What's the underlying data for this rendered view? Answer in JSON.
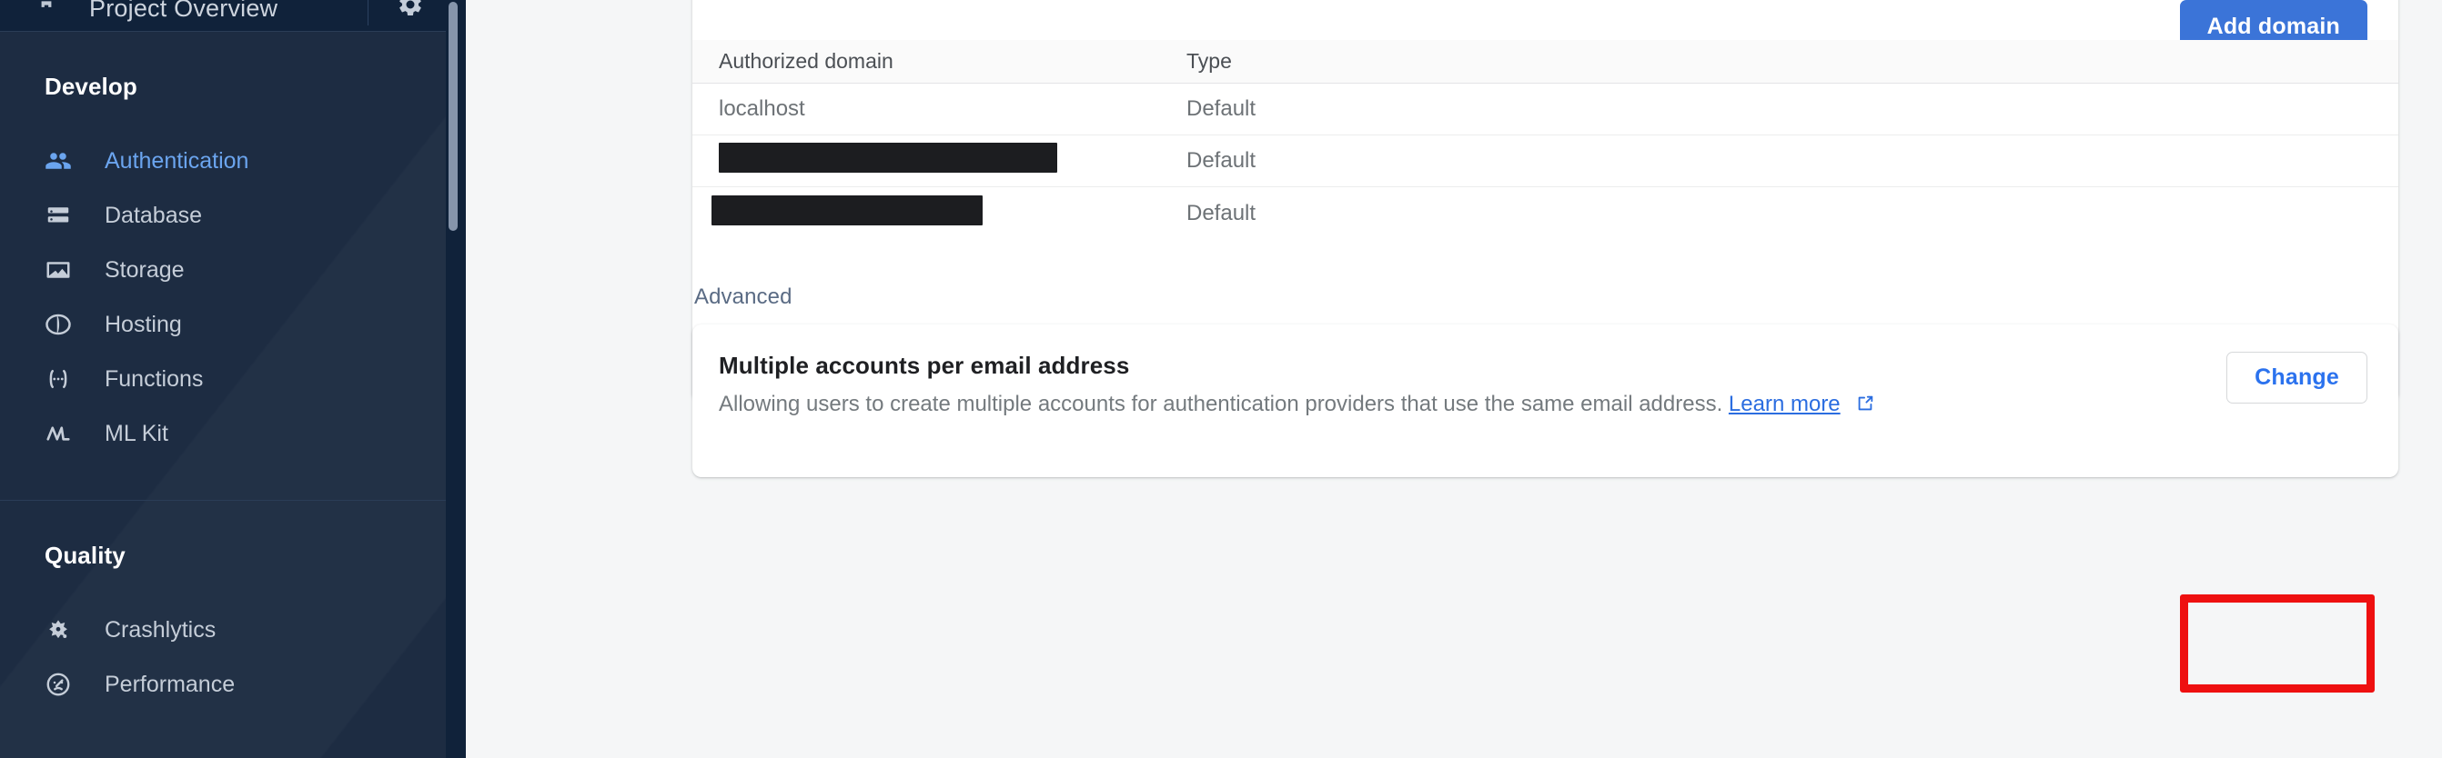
{
  "sidebar": {
    "header": {
      "home_icon": "home-icon",
      "project_title": "Project Overview",
      "settings_icon": "gear-icon"
    },
    "sections": [
      {
        "title": "Develop",
        "items": [
          {
            "label": "Authentication",
            "icon": "people-icon",
            "active": true
          },
          {
            "label": "Database",
            "icon": "database-icon",
            "active": false
          },
          {
            "label": "Storage",
            "icon": "image-icon",
            "active": false
          },
          {
            "label": "Hosting",
            "icon": "globe-icon",
            "active": false
          },
          {
            "label": "Functions",
            "icon": "functions-icon",
            "active": false
          },
          {
            "label": "ML Kit",
            "icon": "ml-kit-icon",
            "active": false
          }
        ]
      },
      {
        "title": "Quality",
        "items": [
          {
            "label": "Crashlytics",
            "icon": "crashlytics-icon",
            "active": false
          },
          {
            "label": "Performance",
            "icon": "performance-icon",
            "active": false
          }
        ]
      }
    ]
  },
  "main": {
    "domains_card": {
      "add_domain_label": "Add domain",
      "columns": [
        "Authorized domain",
        "Type"
      ],
      "rows": [
        {
          "domain": "localhost",
          "redacted": false,
          "redacted_width": 0,
          "type": "Default"
        },
        {
          "domain": "",
          "redacted": true,
          "redacted_width": 372,
          "type": "Default"
        },
        {
          "domain": "",
          "redacted": true,
          "redacted_width": 298,
          "type": "Default"
        }
      ]
    },
    "advanced_label": "Advanced",
    "advanced_card": {
      "title": "Multiple accounts per email address",
      "description": "Allowing users to create multiple accounts for authentication providers that use the same email address.",
      "learn_more_label": "Learn more",
      "external_link_icon": "external-link-icon",
      "change_label": "Change"
    }
  },
  "annotation": {
    "type": "highlight-box",
    "target": "change-button",
    "color": "#ee1010"
  }
}
